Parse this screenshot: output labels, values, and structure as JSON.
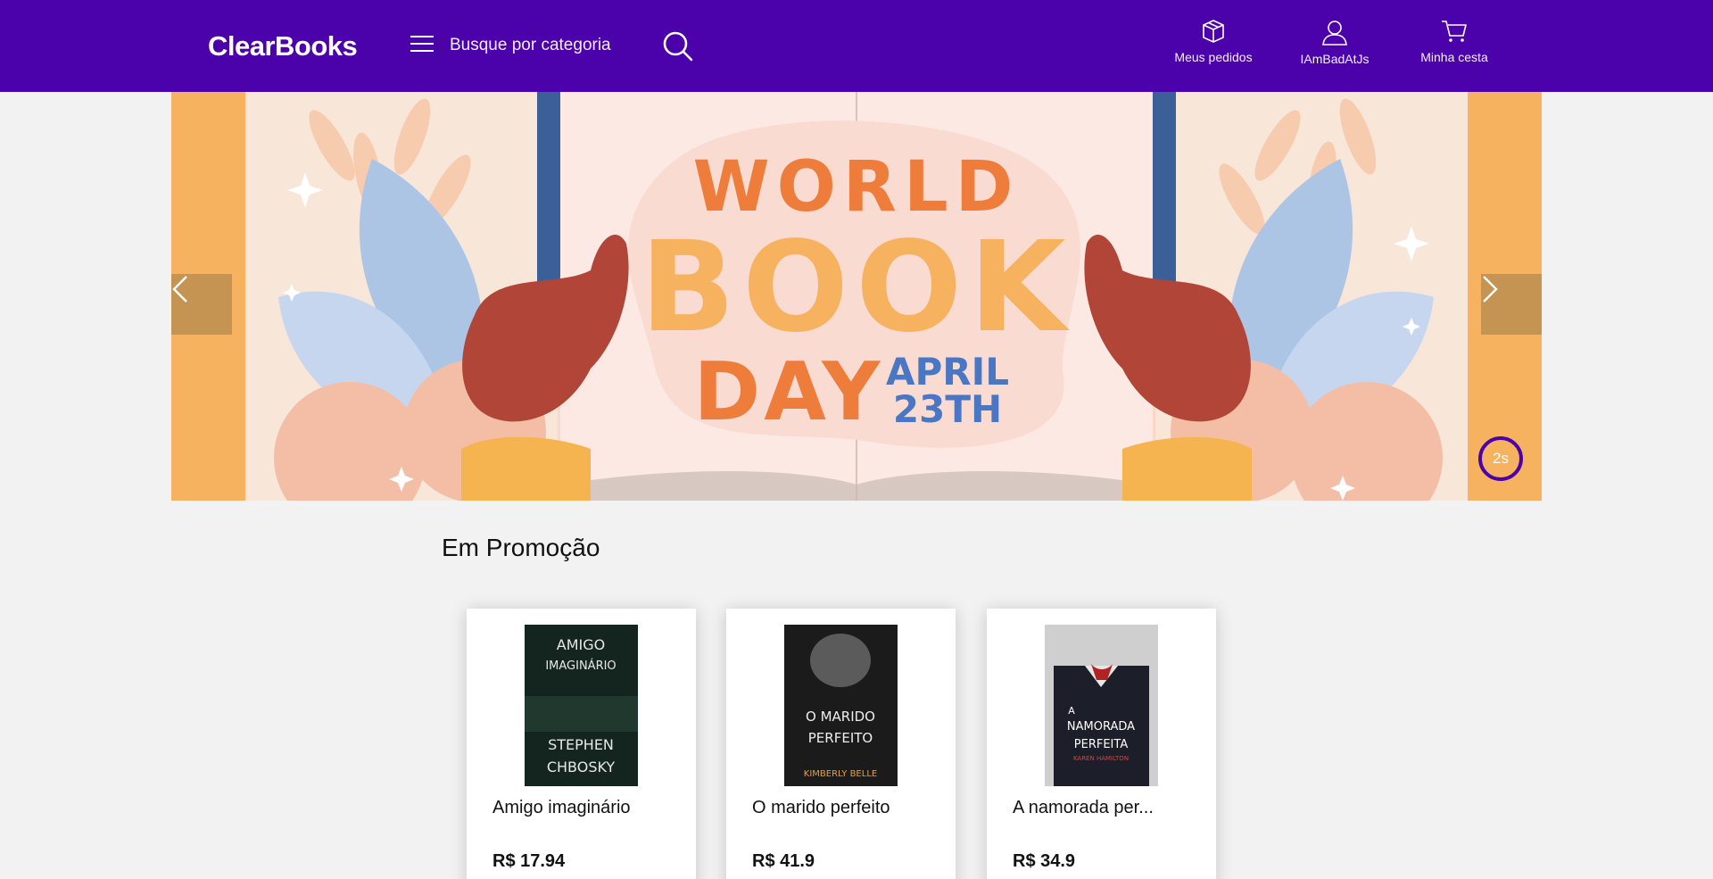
{
  "header": {
    "logo": "ClearBooks",
    "category_label": "Busque por categoria",
    "nav": {
      "orders_label": "Meus pedidos",
      "user_label": "IAmBadAtJs",
      "cart_label": "Minha cesta"
    },
    "icons": {
      "menu": "hamburger-icon",
      "search": "search-icon",
      "orders": "box-icon",
      "user": "user-icon",
      "cart": "cart-icon"
    }
  },
  "banner": {
    "line1": "WORLD",
    "line2": "BOOK",
    "line3": "DAY",
    "date_line1": "APRIL",
    "date_line2": "23TH",
    "timer": "2s"
  },
  "promo": {
    "title": "Em Promoção",
    "products": [
      {
        "title": "Amigo imaginário",
        "price": "R$ 17.94",
        "cover_lines": [
          "AMIGO",
          "IMAGINÁRIO",
          "STEPHEN",
          "CHBOSKY"
        ]
      },
      {
        "title": "O marido perfeito",
        "price": "R$ 41.9",
        "cover_lines": [
          "O MARIDO",
          "PERFEITO",
          "KIMBERLY BELLE"
        ]
      },
      {
        "title": "A namorada per...",
        "price": "R$ 34.9",
        "cover_lines": [
          "A",
          "NAMORADA",
          "PERFEITA",
          "KAREN HAMILTON"
        ]
      }
    ]
  },
  "colors": {
    "brand": "#4b02aa",
    "banner_orange": "#f6b25f",
    "book_orange": "#ee7d3c",
    "book_blue": "#4a77c4"
  }
}
